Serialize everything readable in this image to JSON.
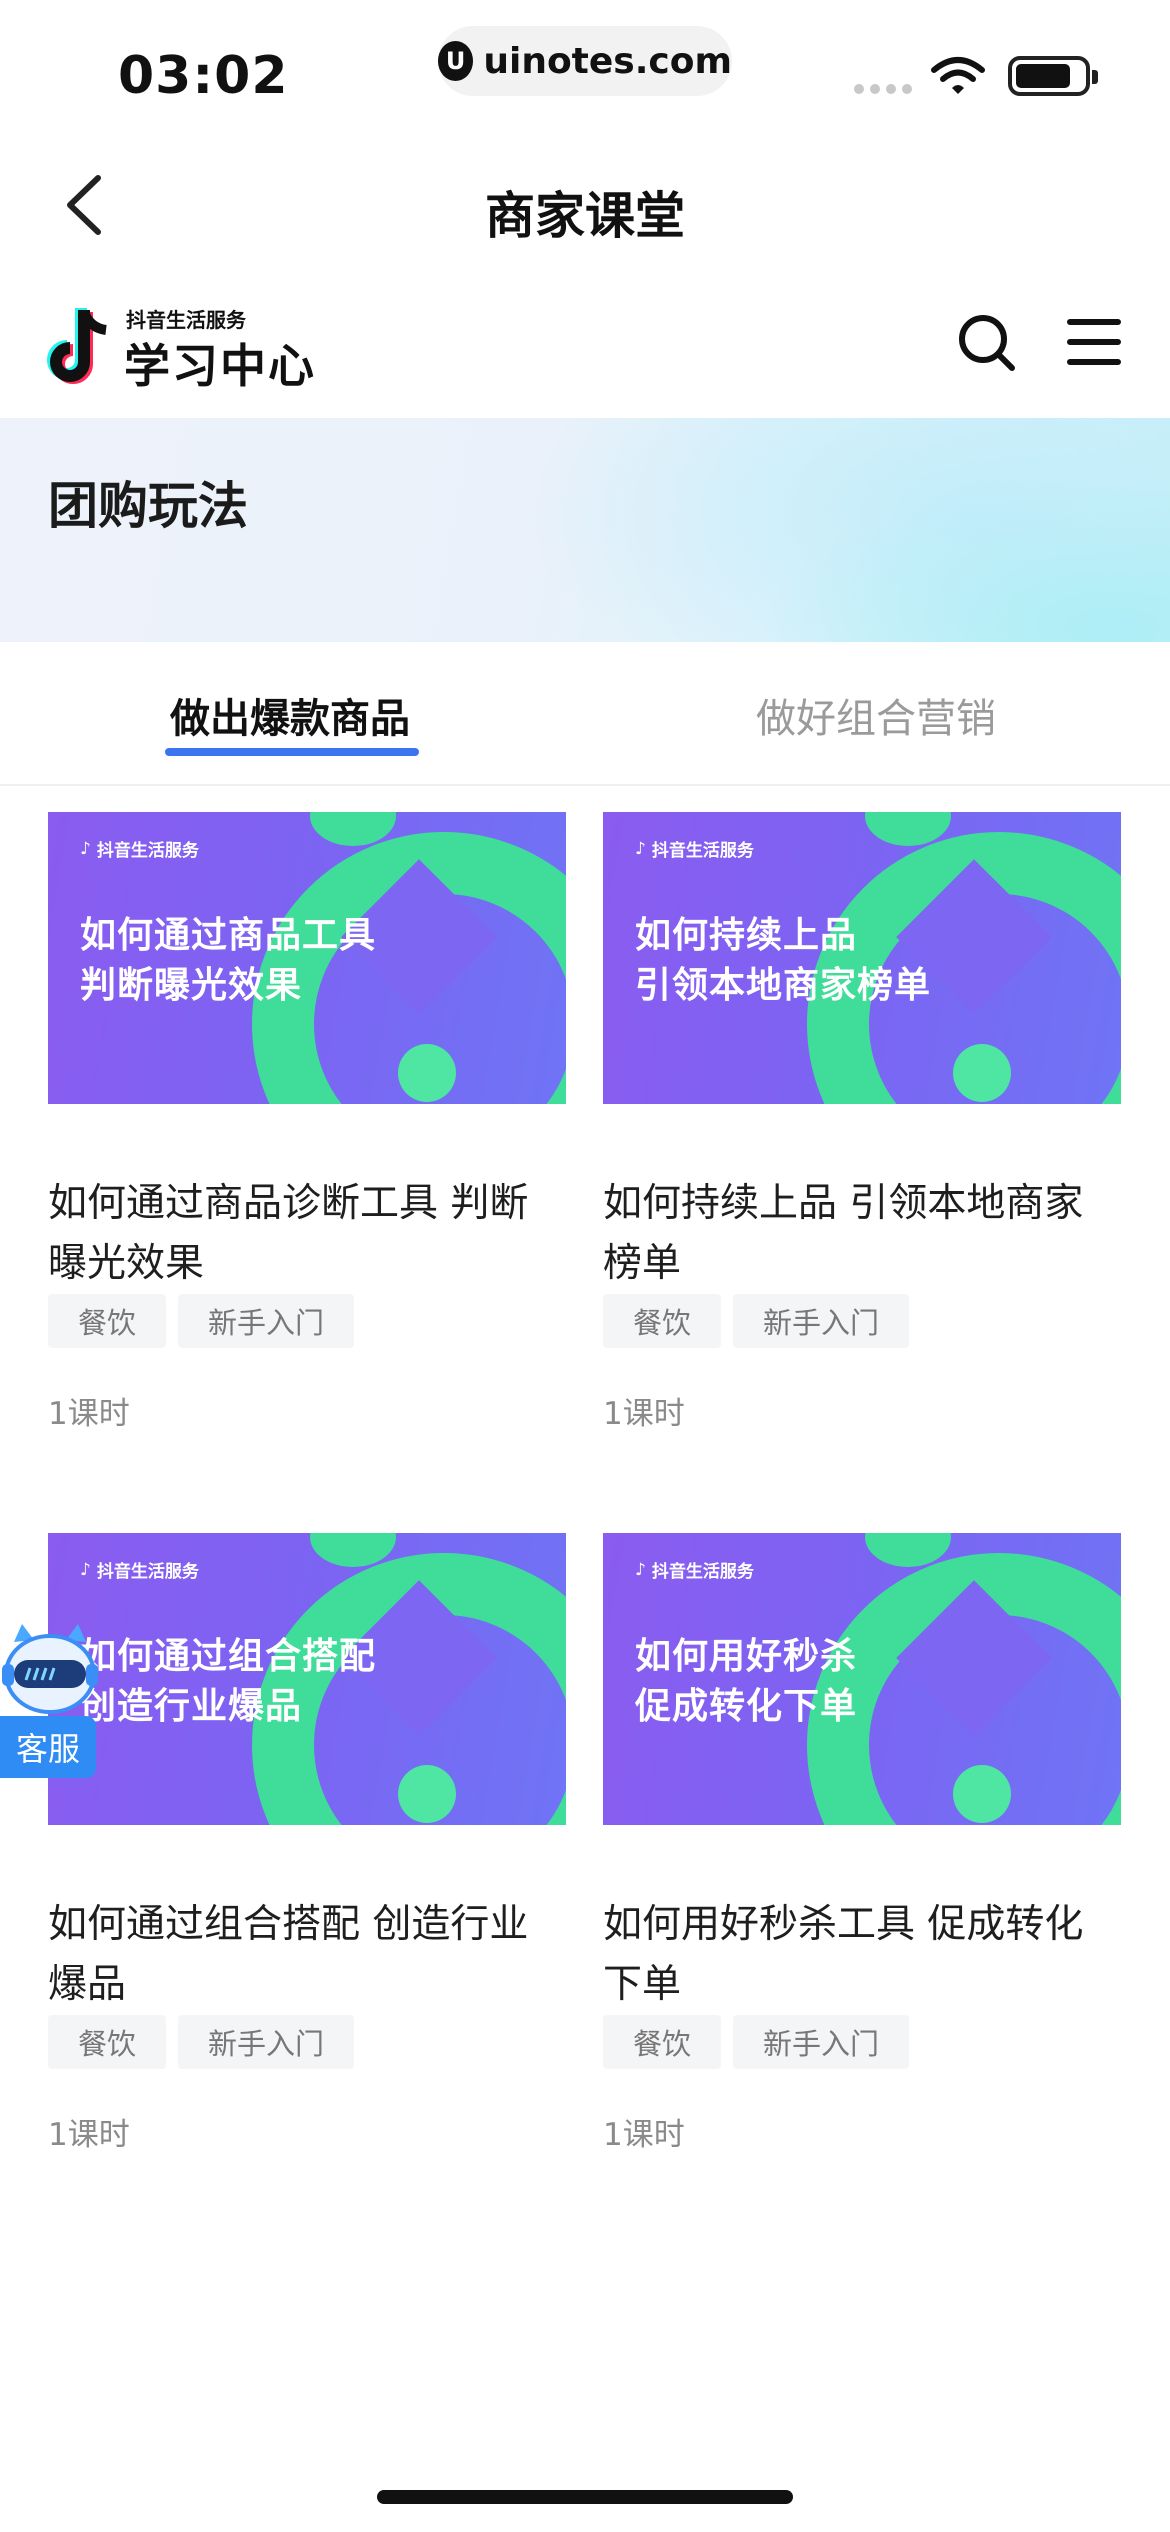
{
  "status_bar": {
    "time": "03:02",
    "url": "uinotes.com",
    "url_logo_glyph": "U"
  },
  "nav": {
    "title": "商家课堂"
  },
  "brand": {
    "sub": "抖音生活服务",
    "main": "学习中心"
  },
  "banner": {
    "title": "团购玩法"
  },
  "tabs": [
    {
      "label": "做出爆款商品",
      "active": true
    },
    {
      "label": "做好组合营销",
      "active": false
    }
  ],
  "thumb_brand": "抖音生活服务",
  "courses": [
    {
      "thumb_line1": "如何通过商品工具",
      "thumb_line2": "判断曝光效果",
      "title": "如何通过商品诊断工具 判断曝光效果",
      "tags": [
        "餐饮",
        "新手入门"
      ],
      "lessons": "1课时"
    },
    {
      "thumb_line1": "如何持续上品",
      "thumb_line2": "引领本地商家榜单",
      "title": "如何持续上品 引领本地商家榜单",
      "tags": [
        "餐饮",
        "新手入门"
      ],
      "lessons": "1课时"
    },
    {
      "thumb_line1": "如何通过组合搭配",
      "thumb_line2": "创造行业爆品",
      "title": "如何通过组合搭配 创造行业爆品",
      "tags": [
        "餐饮",
        "新手入门"
      ],
      "lessons": "1课时"
    },
    {
      "thumb_line1": "如何用好秒杀",
      "thumb_line2": "促成转化下单",
      "title": "如何用好秒杀工具 促成转化下单",
      "tags": [
        "餐饮",
        "新手入门"
      ],
      "lessons": "1课时"
    }
  ],
  "customer_service": {
    "label": "客服"
  },
  "colors": {
    "accent": "#3a74f0",
    "thumb_purple": "#8a5cf0",
    "thumb_green": "#3fdc9a",
    "cs_blue": "#2f8cf5"
  }
}
